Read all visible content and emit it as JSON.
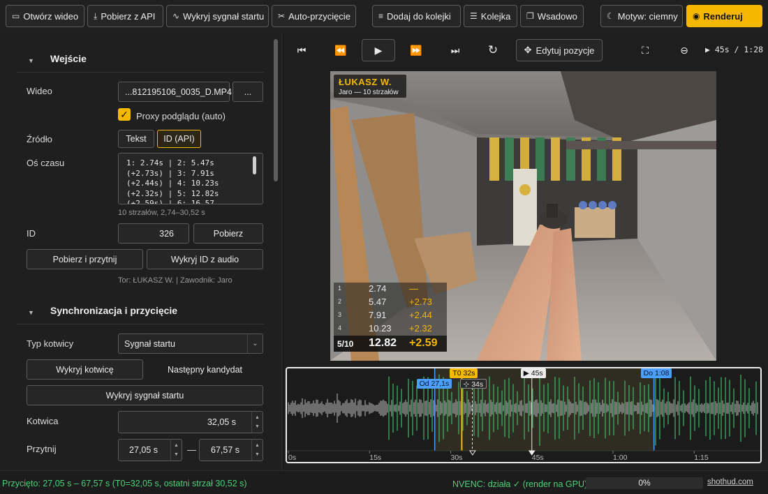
{
  "toolbar": {
    "open_video": "Otwórz wideo",
    "fetch_api": "Pobierz z API",
    "detect_start": "Wykryj sygnał startu",
    "auto_trim": "Auto-przycięcie",
    "add_queue": "Dodaj do kolejki",
    "queue": "Kolejka",
    "batch": "Wsadowo",
    "theme": "Motyw: ciemny",
    "render": "Renderuj"
  },
  "input_section": {
    "title": "Wejście",
    "video_label": "Wideo",
    "video_value": "...812195106_0035_D.MP4",
    "browse": "...",
    "proxy_label": "Proxy podglądu (auto)",
    "source_label": "Źródło",
    "source_text": "Tekst",
    "source_id": "ID (API)",
    "timeline_label": "Oś czasu",
    "timeline_lines": [
      "1: 2.74s | 2: 5.47s",
      "(+2.73s) | 3: 7.91s",
      "(+2.44s) | 4: 10.23s",
      "(+2.32s) | 5: 12.82s",
      "(+2.59s) | 6: 16.57"
    ],
    "timeline_hint": "10 strzałów, 2,74–30,52 s",
    "id_label": "ID",
    "id_value": "326",
    "fetch": "Pobierz",
    "fetch_trim": "Pobierz i przytnij",
    "detect_id": "Wykryj ID z audio",
    "meta_hint": "Tor: ŁUKASZ W.  |  Zawodnik: Jaro"
  },
  "sync_section": {
    "title": "Synchronizacja i przycięcie",
    "anchor_type_label": "Typ kotwicy",
    "anchor_type_value": "Sygnał startu",
    "detect_anchor": "Wykryj kotwicę",
    "next_candidate": "Następny kandydat",
    "detect_start": "Wykryj sygnał startu",
    "anchor_label": "Kotwica",
    "anchor_value": "32,05 s",
    "trim_label": "Przytnij",
    "trim_from": "27,05 s",
    "trim_dash": "—",
    "trim_to": "67,57 s"
  },
  "player": {
    "edit_position": "Edytuj pozycje",
    "time_readout": "▶ 45s / 1:28"
  },
  "hud": {
    "name": "ŁUKASZ W.",
    "sub": "Jaro — 10 strzałów",
    "rows": [
      {
        "i": "1",
        "t": "2.74",
        "d": "—"
      },
      {
        "i": "2",
        "t": "5.47",
        "d": "+2.73"
      },
      {
        "i": "3",
        "t": "7.91",
        "d": "+2.44"
      },
      {
        "i": "4",
        "t": "10.23",
        "d": "+2.32"
      }
    ],
    "current": {
      "i": "5/10",
      "t": "12.82",
      "d": "+2.59"
    }
  },
  "waveform": {
    "markers": {
      "t0": "T0 32s",
      "play": "▶ 45s",
      "from": "Od 27,1s",
      "cursor": "⊹ 34s",
      "to": "Do 1:08"
    },
    "ticks": [
      "0s",
      "15s",
      "30s",
      "45s",
      "1:00",
      "1:15"
    ],
    "duration_s": 88,
    "trim_from_s": 27.05,
    "trim_to_s": 67.57,
    "anchor_s": 32.05,
    "playhead_s": 45,
    "cursor_s": 34,
    "colors": {
      "wave": "#9a9a9a",
      "shot": "#3fae63",
      "trim_bg": "#2f2d22",
      "t0": "#f5b800",
      "edge": "#4a9fff"
    }
  },
  "status": {
    "left": "Przycięto: 27,05 s – 67,57 s (T0=32,05 s, ostatni strzał 30,52 s)",
    "gpu": "NVENC: działa ✓ (render na GPU)",
    "progress": "0%",
    "progress_value": 0,
    "brand": "shothud.com"
  },
  "colors": {
    "accent": "#f5b800",
    "ok": "#4fd07a"
  }
}
